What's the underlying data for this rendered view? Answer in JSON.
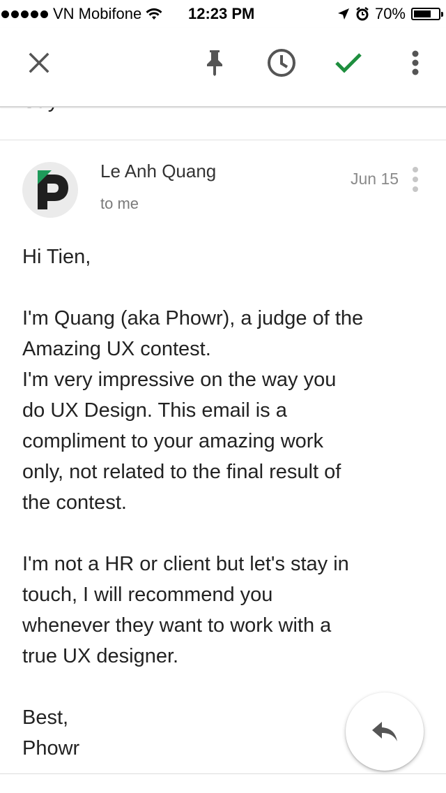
{
  "status_bar": {
    "carrier": "VN Mobifone",
    "time": "12:23 PM",
    "battery": "70%",
    "battery_level": 0.7,
    "icons": [
      "signal-dots-icon",
      "wifi-icon",
      "location-arrow-icon",
      "alarm-icon",
      "battery-icon"
    ]
  },
  "toolbar": {
    "icons": [
      "close-icon",
      "pin-icon",
      "snooze-clock-icon",
      "check-icon",
      "more-vert-icon"
    ],
    "accent_color": "#1e8e3e"
  },
  "subject_peek": "Say hi",
  "message": {
    "sender": "Le Anh Quang",
    "recipient": "to me",
    "date": "Jun 15",
    "greeting": "Hi Tien,",
    "paragraph1": [
      "I'm Quang (aka Phowr), a judge of the",
      "Amazing UX contest.",
      "I'm very impressive on the way you",
      "do UX Design. This email is a",
      "compliment to your amazing work",
      "only, not related to the final result of",
      "the contest."
    ],
    "paragraph2": [
      "I'm not a HR or client but let's stay in",
      "touch, I will recommend you",
      "whenever they want to work with a",
      "true UX designer."
    ],
    "signoff": "Best,",
    "signature": "Phowr"
  },
  "fab": {
    "icon": "reply-icon"
  }
}
